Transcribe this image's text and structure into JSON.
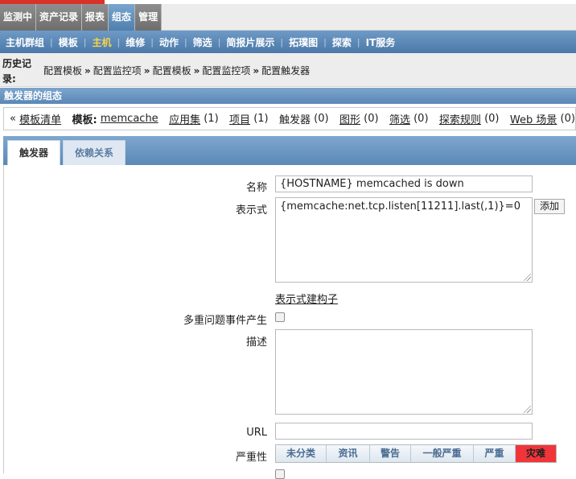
{
  "top_menu": {
    "items": [
      {
        "label": "监测中"
      },
      {
        "label": "资产记录"
      },
      {
        "label": "报表"
      },
      {
        "label": "组态",
        "active": true
      },
      {
        "label": "管理"
      }
    ]
  },
  "sub_menu": {
    "items": [
      {
        "label": "主机群组"
      },
      {
        "label": "模板"
      },
      {
        "label": "主机",
        "active": true
      },
      {
        "label": "维修"
      },
      {
        "label": "动作"
      },
      {
        "label": "筛选"
      },
      {
        "label": "简报片展示"
      },
      {
        "label": "拓璞图"
      },
      {
        "label": "探索"
      },
      {
        "label": "IT服务"
      }
    ]
  },
  "history": {
    "label": "历史记录:",
    "crumbs": [
      "配置模板",
      "配置监控项",
      "配置模板",
      "配置监控项",
      "配置触发器"
    ]
  },
  "title_bar": "触发器的组态",
  "nav": {
    "back_prefix": "«",
    "back_link": "模板清单",
    "template_label": "模板:",
    "template_name": "memcache",
    "applications": {
      "label": "应用集",
      "count": "(1)"
    },
    "items": {
      "label": "项目",
      "count": "(1)"
    },
    "triggers": {
      "label": "触发器",
      "count": "(0)"
    },
    "graphs": {
      "label": "图形",
      "count": "(0)"
    },
    "screens": {
      "label": "筛选",
      "count": "(0)"
    },
    "discovery": {
      "label": "探索规则",
      "count": "(0)"
    },
    "web": {
      "label": "Web 场景",
      "count": "(0)"
    }
  },
  "tabs": [
    {
      "label": "触发器",
      "active": true
    },
    {
      "label": "依赖关系"
    }
  ],
  "form": {
    "name_label": "名称",
    "name_value": "{HOSTNAME} memcached is down",
    "expression_label": "表示式",
    "expression_value": "{memcache:net.tcp.listen[11211].last(,1)}=0",
    "add_button": "添加",
    "expression_builder_link": "表示式建构子",
    "multiple_events_label": "多重问题事件产生",
    "multiple_events_checked": false,
    "description_label": "描述",
    "description_value": "",
    "url_label": "URL",
    "url_value": "",
    "severity_label": "严重性",
    "severity_options": [
      "未分类",
      "资讯",
      "警告",
      "一般严重",
      "严重",
      "灾难"
    ],
    "severity_selected": "灾难"
  },
  "colors": {
    "menu_active": "#5b8bbd",
    "submenu_bg": "#5a86b5",
    "submenu_active_text": "#f6d34a",
    "severity_disaster": "#f0353a"
  }
}
